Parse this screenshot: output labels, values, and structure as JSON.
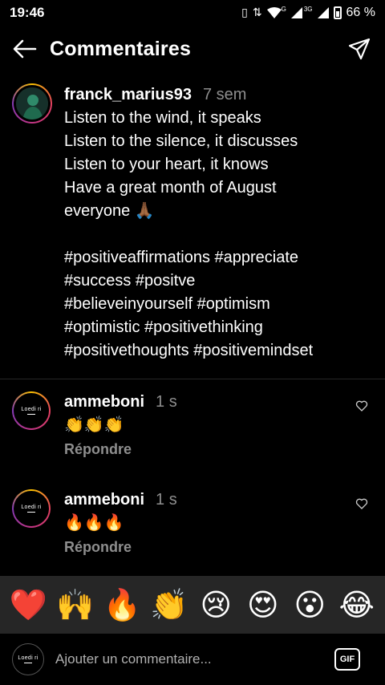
{
  "status_bar": {
    "time": "19:46",
    "network_label_1": "G",
    "network_label_2": "3G",
    "battery": "66 %"
  },
  "header": {
    "title": "Commentaires"
  },
  "caption": {
    "username": "franck_marius93",
    "time": "7 sem",
    "text": "Listen to the wind, it speaks\nListen to the silence, it discusses\nListen to your heart, it knows\nHave a great month of August\neveryone 🙏🏾",
    "hashtags": "#positiveaffirmations #appreciate\n#success #positve\n#believeinyourself #optimism\n#optimistic #positivethinking\n#positivethoughts #positivemindset"
  },
  "comments": [
    {
      "username": "ammeboni",
      "time": "1 s",
      "text": "👏👏👏",
      "reply_label": "Répondre",
      "avatar_text": "Loedi ri"
    },
    {
      "username": "ammeboni",
      "time": "1 s",
      "text": "🔥🔥🔥",
      "reply_label": "Répondre",
      "avatar_text": "Loedi ri"
    }
  ],
  "emoji_bar": [
    "❤️",
    "🙌",
    "🔥",
    "👏",
    "😢",
    "😍",
    "😮",
    "😂"
  ],
  "input": {
    "placeholder": "Ajouter un commentaire...",
    "gif_label": "GIF",
    "avatar_text": "Loedi ri"
  },
  "colors": {
    "background": "#000000",
    "secondary_text": "#8e8e8e",
    "emoji_bar_bg": "#262626"
  }
}
